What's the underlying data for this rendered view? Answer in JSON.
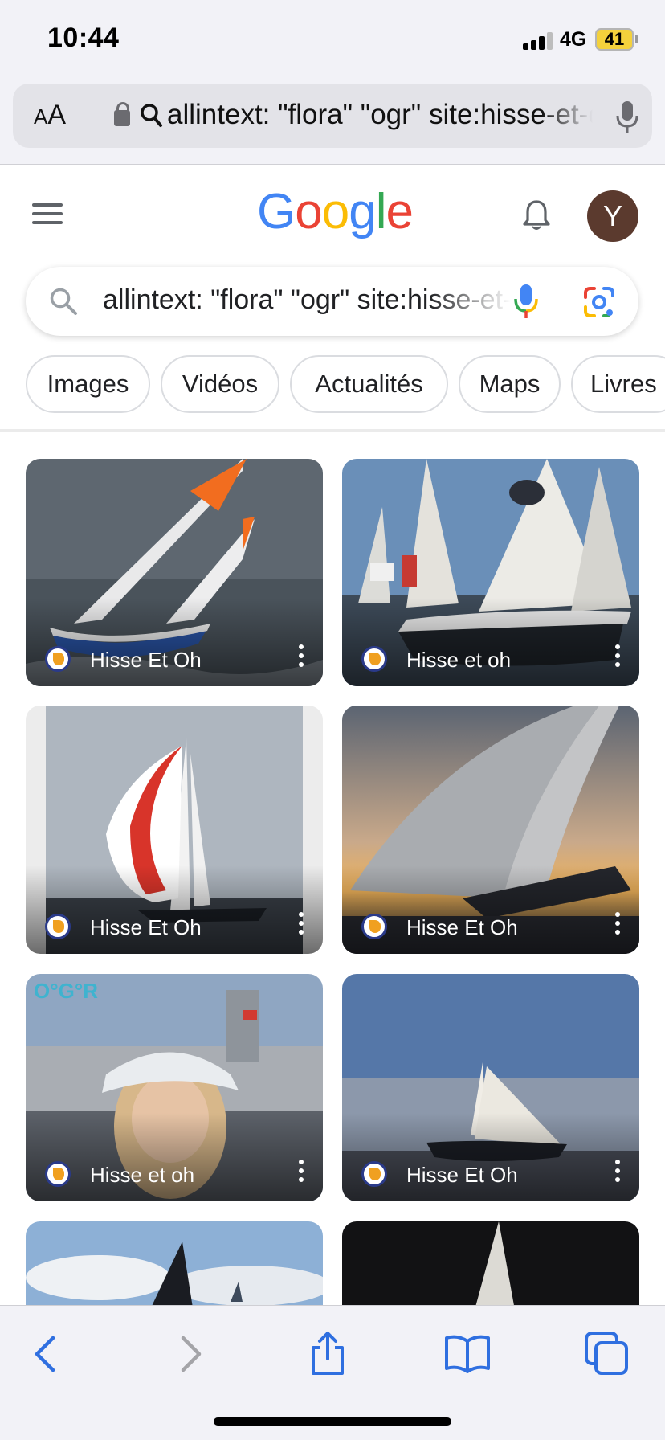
{
  "status_bar": {
    "time": "10:44",
    "network": "4G",
    "battery": "41"
  },
  "address_bar": {
    "text_size_label": "AA",
    "url": "allintext: \"flora\" \"ogr\" site:hisse-et-oh.com"
  },
  "header": {
    "logo": "Google",
    "avatar_letter": "Y"
  },
  "search": {
    "query": "allintext:  \"flora\"  \"ogr\"  site:hisse-et-oh.com"
  },
  "chips": [
    "Images",
    "Vidéos",
    "Actualités",
    "Maps",
    "Livres"
  ],
  "results": [
    {
      "site": "Hisse Et Oh"
    },
    {
      "site": "Hisse et oh"
    },
    {
      "site": "Hisse Et Oh"
    },
    {
      "site": "Hisse Et Oh"
    },
    {
      "site": "Hisse et oh"
    },
    {
      "site": "Hisse Et Oh"
    },
    {
      "site": ""
    },
    {
      "site": ""
    }
  ],
  "colors": {
    "google_blue": "#4285F4",
    "google_red": "#EA4335",
    "google_yellow": "#FBBC05",
    "google_green": "#34A853",
    "safari_blue": "#2f6fe0"
  },
  "toolbar": [
    "back-icon",
    "forward-icon",
    "share-icon",
    "bookmarks-icon",
    "tabs-icon"
  ]
}
